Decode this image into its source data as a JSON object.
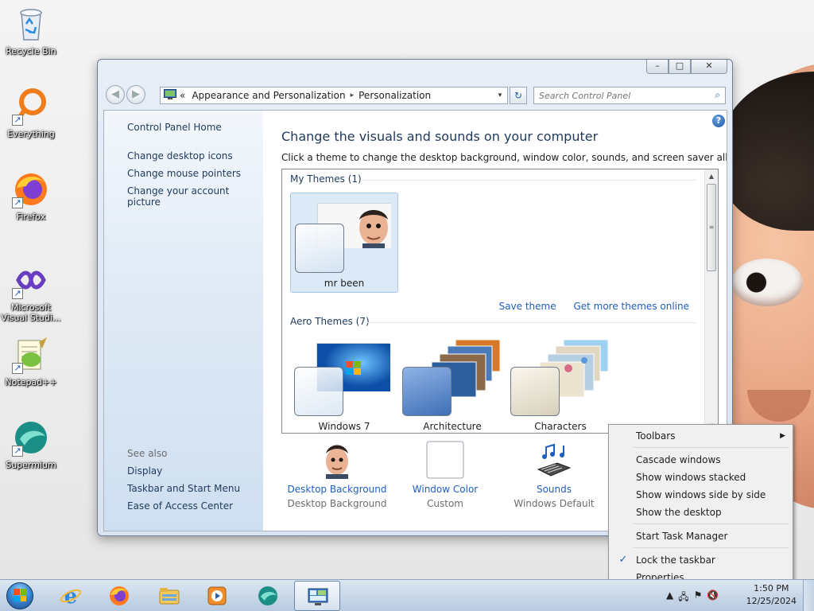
{
  "desktop": {
    "icons": [
      {
        "label": "Recycle Bin",
        "icon": "recycle-bin-icon"
      },
      {
        "label": "Everything",
        "icon": "everything-icon"
      },
      {
        "label": "Firefox",
        "icon": "firefox-icon"
      },
      {
        "label": "Microsoft Visual Studi...",
        "icon": "visual-studio-icon"
      },
      {
        "label": "Notepad++",
        "icon": "notepad-plus-plus-icon"
      },
      {
        "label": "Supermium",
        "icon": "supermium-icon"
      }
    ]
  },
  "window": {
    "caption_buttons": {
      "minimize": "–",
      "maximize": "□",
      "close": "✕"
    },
    "address": {
      "prefix": "«",
      "crumbs": [
        "Appearance and Personalization",
        "Personalization"
      ],
      "separator": "▸",
      "dropdown": "▾"
    },
    "refresh": "↻",
    "search": {
      "placeholder": "Search Control Panel"
    },
    "help": "?",
    "sidebar": {
      "home": "Control Panel Home",
      "links": [
        "Change desktop icons",
        "Change mouse pointers",
        "Change your account picture"
      ],
      "see_also_heading": "See also",
      "see_also": [
        "Display",
        "Taskbar and Start Menu",
        "Ease of Access Center"
      ]
    },
    "main": {
      "title": "Change the visuals and sounds on your computer",
      "subtitle": "Click a theme to change the desktop background, window color, sounds, and screen saver all at once.",
      "my_themes_heading": "My Themes (1)",
      "my_themes": [
        {
          "name": "mr been"
        }
      ],
      "save_theme": "Save theme",
      "get_more": "Get more themes online",
      "aero_heading": "Aero Themes (7)",
      "aero_themes": [
        {
          "name": "Windows 7"
        },
        {
          "name": "Architecture"
        },
        {
          "name": "Characters"
        }
      ],
      "bottom": [
        {
          "link": "Desktop Background",
          "value": "Desktop Background",
          "icon": "desktop-background-icon"
        },
        {
          "link": "Window Color",
          "value": "Custom",
          "icon": "window-color-icon"
        },
        {
          "link": "Sounds",
          "value": "Windows Default",
          "icon": "sounds-icon"
        }
      ]
    }
  },
  "context_menu": {
    "toolbars": "Toolbars",
    "cascade": "Cascade windows",
    "stacked": "Show windows stacked",
    "side_by_side": "Show windows side by side",
    "show_desktop": "Show the desktop",
    "task_manager": "Start Task Manager",
    "lock_taskbar": "Lock the taskbar",
    "lock_checked": true,
    "properties": "Properties"
  },
  "taskbar": {
    "items": [
      {
        "icon": "internet-explorer-icon"
      },
      {
        "icon": "firefox-icon"
      },
      {
        "icon": "file-explorer-icon"
      },
      {
        "icon": "media-player-icon"
      },
      {
        "icon": "supermium-icon"
      },
      {
        "icon": "control-panel-icon",
        "active": true
      }
    ],
    "clock": {
      "time": "1:50 PM",
      "date": "12/25/2024"
    }
  }
}
